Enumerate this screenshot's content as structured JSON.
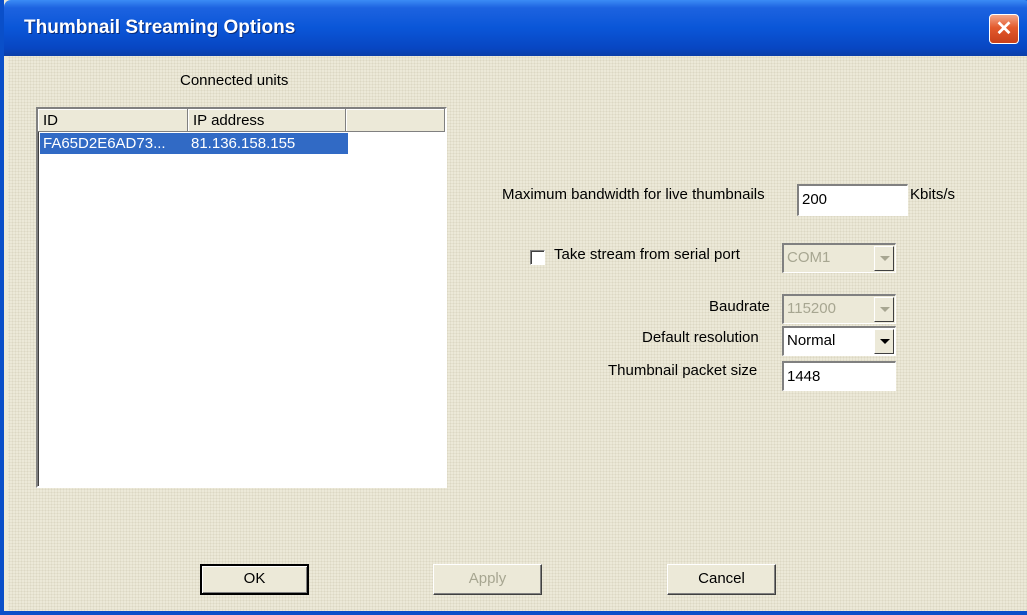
{
  "window": {
    "title": "Thumbnail Streaming Options",
    "close_glyph": "✕"
  },
  "connected_units": {
    "label": "Connected units",
    "columns": [
      "ID",
      "IP address"
    ],
    "rows": [
      {
        "id": "FA65D2E6AD73...",
        "ip": "81.136.158.155",
        "selected": true
      }
    ]
  },
  "bandwidth": {
    "label": "Maximum bandwidth for live thumbnails",
    "value": "200",
    "unit": "Kbits/s"
  },
  "serial": {
    "label": "Take stream from serial port",
    "checked": false,
    "port": "COM1"
  },
  "baudrate": {
    "label": "Baudrate",
    "value": "115200"
  },
  "resolution": {
    "label": "Default resolution",
    "value": "Normal"
  },
  "packet_size": {
    "label": "Thumbnail packet size",
    "value": "1448"
  },
  "buttons": {
    "ok": "OK",
    "apply": "Apply",
    "cancel": "Cancel"
  },
  "colors": {
    "title_bar": "#0a56d8",
    "selection": "#316ac5",
    "dialog_bg": "#ece9d8",
    "close_button": "#e35a2d"
  }
}
